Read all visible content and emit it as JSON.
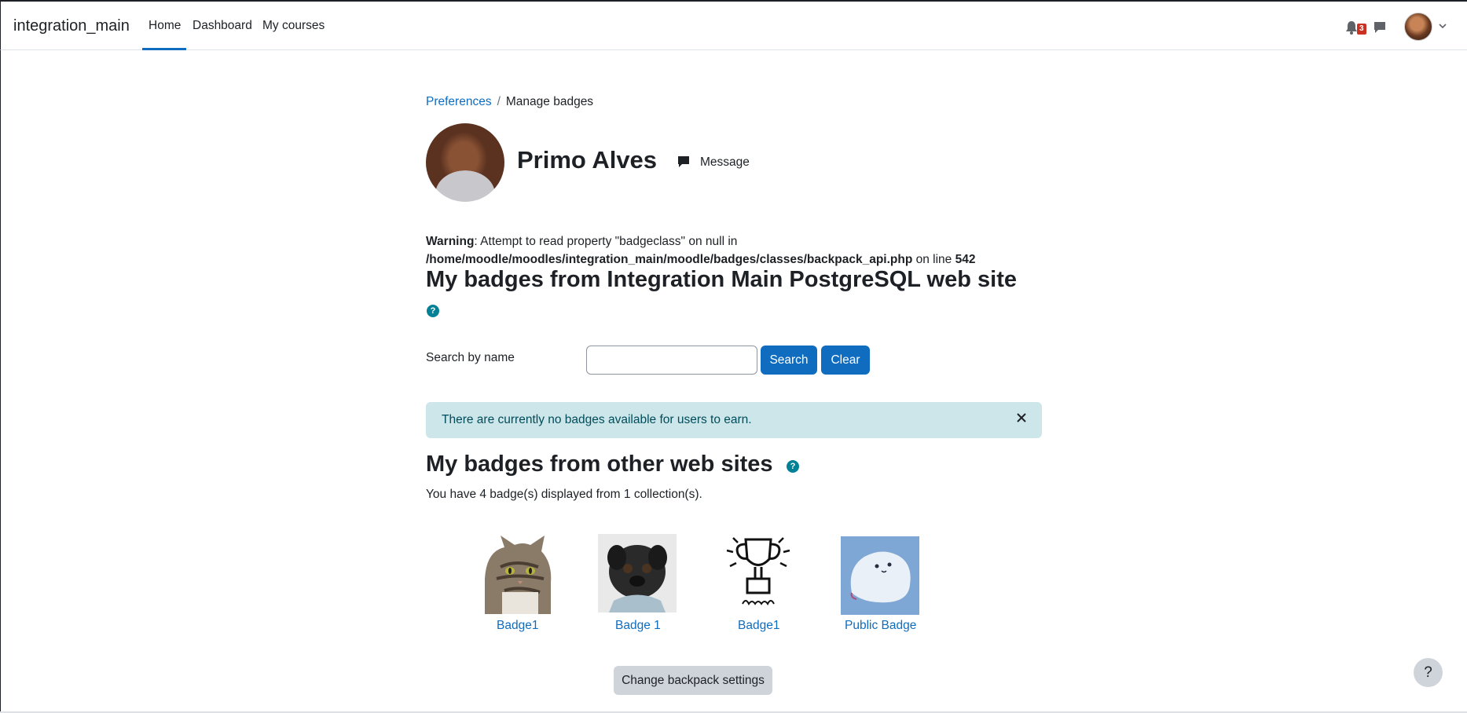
{
  "navbar": {
    "brand": "integration_main",
    "links": [
      {
        "label": "Home"
      },
      {
        "label": "Dashboard"
      },
      {
        "label": "My courses"
      }
    ],
    "notification_count": "3"
  },
  "breadcrumb": {
    "parent": "Preferences",
    "separator": "/",
    "current": "Manage badges"
  },
  "profile": {
    "name": "Primo Alves",
    "message_label": "Message"
  },
  "warning": {
    "label": "Warning",
    "text": ": Attempt to read property \"badgeclass\" on null in ",
    "path": "/home/moodle/moodles/integration_main/moodle/badges/classes/backpack_api.php",
    "line_prefix": " on line ",
    "line": "542"
  },
  "main_heading": "My badges from Integration Main PostgreSQL web site",
  "help_glyph": "?",
  "search": {
    "label": "Search by name",
    "value": "",
    "placeholder": "",
    "search_button": "Search",
    "clear_button": "Clear"
  },
  "alert": {
    "text": "There are currently no badges available for users to earn."
  },
  "other_heading": "My badges from other web sites",
  "badge_count_text": "You have 4 badge(s) displayed from 1 collection(s).",
  "badges": [
    {
      "label": "Badge1",
      "image": "cat"
    },
    {
      "label": "Badge 1",
      "image": "pug"
    },
    {
      "label": "Badge1",
      "image": "trophy-expert"
    },
    {
      "label": "Public Badge",
      "image": "ghost-blob"
    }
  ],
  "backpack_button": "Change backpack settings",
  "help_fab": "?",
  "colors": {
    "primary": "#0f6cbf",
    "info_bg": "#cce6ea",
    "help_teal": "#008196",
    "secondary_btn": "#ced4da"
  }
}
